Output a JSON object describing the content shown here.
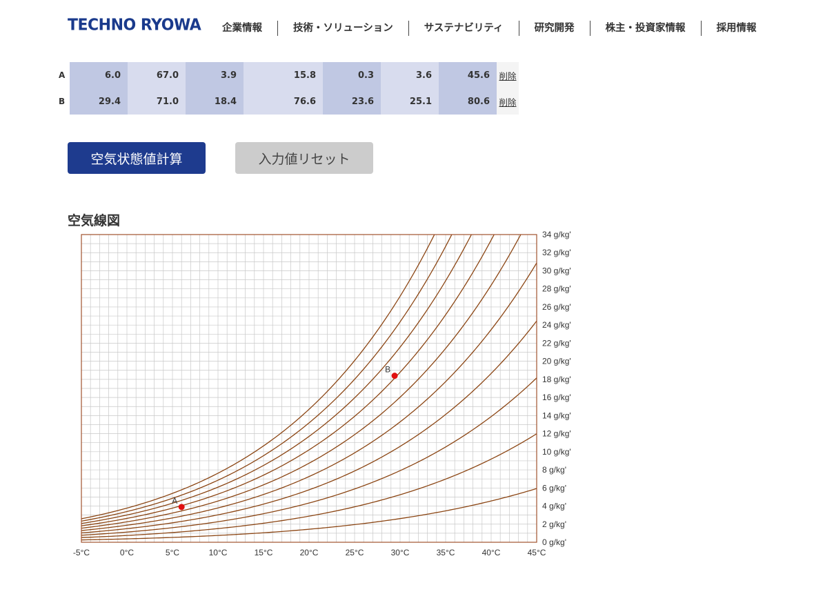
{
  "header": {
    "logo_text": "TECHNO RYOWA",
    "nav": [
      "企業情報",
      "技術・ソリューション",
      "サステナビリティ",
      "研究開発",
      "株主・投資家情報",
      "採用情報"
    ]
  },
  "table": {
    "delete_label": "削除",
    "rows": [
      {
        "label": "A",
        "values": [
          "6.0",
          "67.0",
          "3.9",
          "15.8",
          "0.3",
          "3.6",
          "45.6"
        ]
      },
      {
        "label": "B",
        "values": [
          "29.4",
          "71.0",
          "18.4",
          "76.6",
          "23.6",
          "25.1",
          "80.6"
        ]
      }
    ]
  },
  "buttons": {
    "calculate": "空気状態値計算",
    "reset": "入力値リセット"
  },
  "chart_title": "空気線図",
  "chart_data": {
    "type": "line",
    "xlim": [
      -5,
      45
    ],
    "ylim": [
      0,
      34
    ],
    "x_ticks": [
      "-5°C",
      "0°C",
      "5°C",
      "10°C",
      "15°C",
      "20°C",
      "25°C",
      "30°C",
      "35°C",
      "40°C",
      "45°C"
    ],
    "y_ticks": [
      "0 g/kg'",
      "2 g/kg'",
      "4 g/kg'",
      "6 g/kg'",
      "8 g/kg'",
      "10 g/kg'",
      "12 g/kg'",
      "14 g/kg'",
      "16 g/kg'",
      "18 g/kg'",
      "20 g/kg'",
      "22 g/kg'",
      "24 g/kg'",
      "26 g/kg'",
      "28 g/kg'",
      "30 g/kg'",
      "32 g/kg'",
      "34 g/kg'"
    ],
    "grid": true,
    "relative_humidity_curves": [
      10,
      20,
      30,
      40,
      50,
      60,
      70,
      80,
      90,
      100
    ],
    "points": [
      {
        "label": "A",
        "x": 6.0,
        "y": 3.9
      },
      {
        "label": "B",
        "x": 29.4,
        "y": 18.4
      }
    ],
    "colors": {
      "curve": "#8b4513",
      "frame": "#a0522d",
      "grid": "#c8c8c8",
      "point": "#e01010"
    }
  }
}
